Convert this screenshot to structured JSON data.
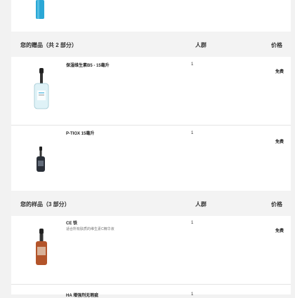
{
  "sections": [
    {
      "header": {
        "title": "您的赠品（共 2 部分）",
        "qty_label": "人群",
        "price_label": "价格"
      },
      "items": [
        {
          "name": "保湿维生素B5 - 15毫升",
          "qty": "1",
          "price": "免费"
        },
        {
          "name": "P-TIOX 15毫升",
          "qty": "1",
          "price": "免费"
        }
      ]
    },
    {
      "header": {
        "title": "您的样品（3 部分）",
        "qty_label": "人群",
        "price_label": "价格"
      },
      "items": [
        {
          "name": "CE 铁",
          "description": "适合所有肤质的维生素C精华液",
          "qty": "1",
          "price": "免费"
        },
        {
          "name": "HA 增强剂无瑕疵",
          "qty": "1"
        }
      ]
    }
  ],
  "colors": {
    "page_bg": "#f2f2f2",
    "header_bg": "#f3f3f3",
    "bottle_blue": "#2aa7d6",
    "dropper_dark": "#222222",
    "amber": "#b3542a"
  }
}
